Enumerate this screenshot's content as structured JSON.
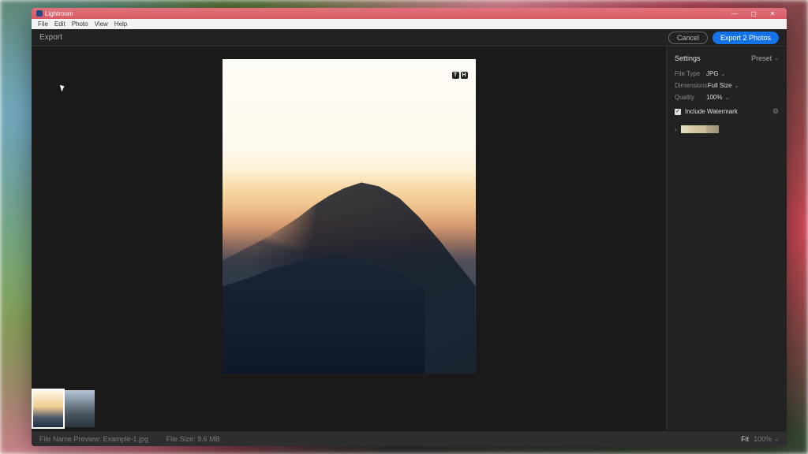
{
  "app": {
    "name": "Lightroom"
  },
  "menu": {
    "items": [
      "File",
      "Edit",
      "Photo",
      "View",
      "Help"
    ]
  },
  "toolbar": {
    "title": "Export",
    "cancel": "Cancel",
    "export": "Export 2 Photos"
  },
  "settings": {
    "title": "Settings",
    "preset_label": "Preset",
    "rows": {
      "file_type": {
        "label": "File Type",
        "value": "JPG"
      },
      "dimensions": {
        "label": "Dimensions",
        "value": "Full Size"
      },
      "quality": {
        "label": "Quality",
        "value": "100%"
      }
    },
    "watermark": {
      "label": "Include Watermark",
      "checked": true
    }
  },
  "thumbnails": {
    "count": 2,
    "selected_index": 0
  },
  "status": {
    "filename_label": "File Name Preview:",
    "filename_value": "Example-1.jpg",
    "filesize_label": "File Size:",
    "filesize_value": "9.6 MB",
    "fit_label": "Fit",
    "zoom": "100%"
  },
  "watermark_overlay": {
    "char1": "T",
    "char2": "H"
  },
  "window_controls": {
    "min": "—",
    "max": "▢",
    "close": "✕"
  }
}
